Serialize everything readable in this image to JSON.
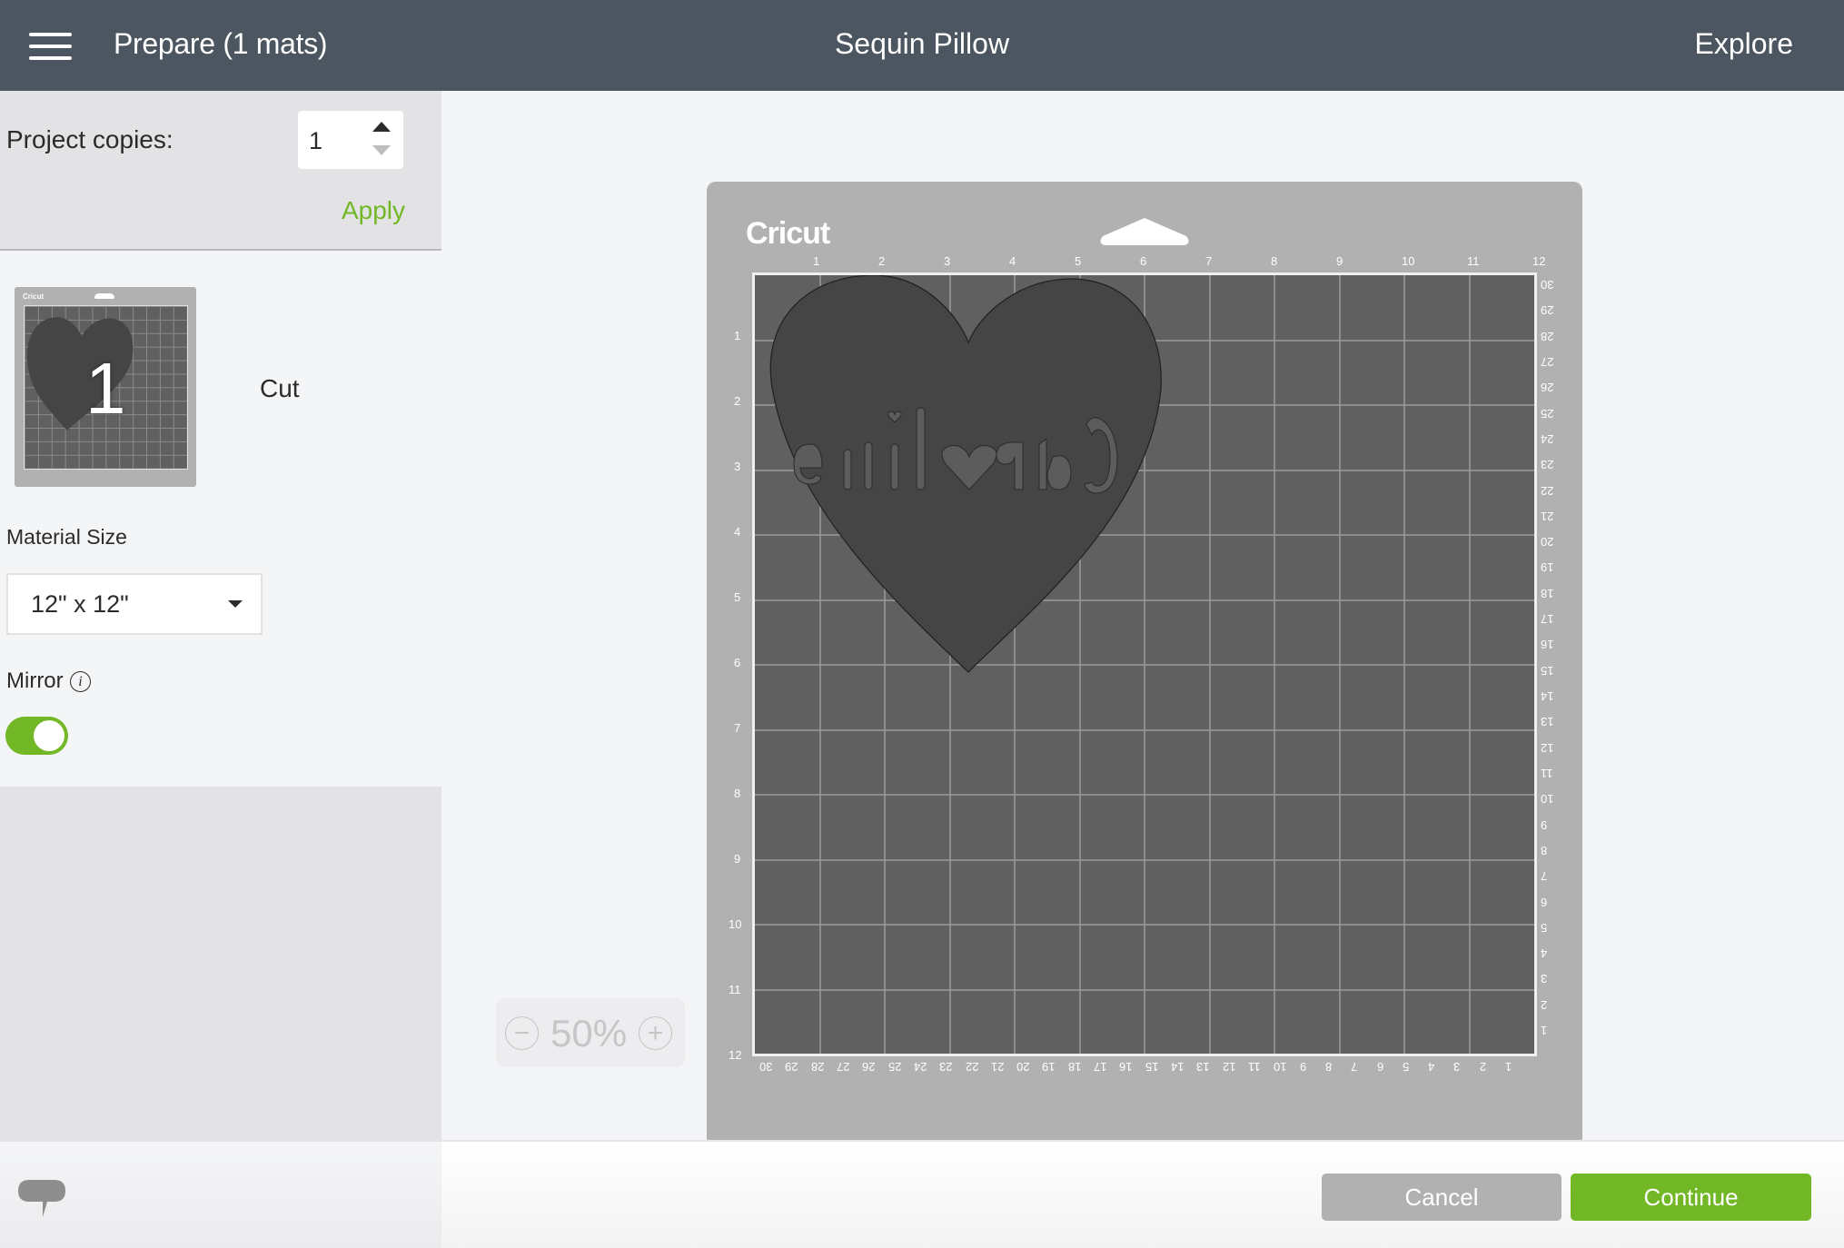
{
  "header": {
    "menu_icon": "hamburger-menu-icon",
    "title": "Prepare (1 mats)",
    "project_name": "Sequin Pillow",
    "explore_label": "Explore"
  },
  "sidebar": {
    "copies_label": "Project copies:",
    "copies_value": "1",
    "apply_label": "Apply",
    "mats": [
      {
        "number": "1",
        "label": "Cut",
        "thumb_logo": "Cricut"
      }
    ],
    "material_size_label": "Material Size",
    "material_size_value": "12\" x 12\"",
    "mirror_label": "Mirror",
    "mirror_info_icon": "i",
    "mirror_enabled": true
  },
  "mat": {
    "logo": "Cricut",
    "design_text_mirrored": "Caroline",
    "design_shape": "heart",
    "ruler_top": [
      "1",
      "2",
      "3",
      "4",
      "5",
      "6",
      "7",
      "8",
      "9",
      "10",
      "11",
      "12"
    ],
    "ruler_left": [
      "1",
      "2",
      "3",
      "4",
      "5",
      "6",
      "7",
      "8",
      "9",
      "10",
      "11",
      "12"
    ],
    "ruler_right_cm": [
      "30",
      "29",
      "28",
      "27",
      "26",
      "25",
      "24",
      "23",
      "22",
      "21",
      "20",
      "19",
      "18",
      "17",
      "16",
      "15",
      "14",
      "13",
      "12",
      "11",
      "10",
      "9",
      "8",
      "7",
      "6",
      "5",
      "4",
      "3",
      "2",
      "1"
    ],
    "ruler_bottom_cm": [
      "30",
      "29",
      "28",
      "27",
      "26",
      "25",
      "24",
      "23",
      "22",
      "21",
      "20",
      "19",
      "18",
      "17",
      "16",
      "15",
      "14",
      "13",
      "12",
      "11",
      "10",
      "9",
      "8",
      "7",
      "6",
      "5",
      "4",
      "3",
      "2",
      "1"
    ]
  },
  "zoom": {
    "minus": "−",
    "value": "50%",
    "plus": "+"
  },
  "footer": {
    "feedback_icon": "chat-bubble-icon",
    "cancel_label": "Cancel",
    "continue_label": "Continue"
  },
  "colors": {
    "header_bg": "#4b5660",
    "accent_green": "#72b725",
    "mat_gray": "#b1b1b1",
    "grid_gray": "#606060",
    "design_fill": "#454545"
  }
}
